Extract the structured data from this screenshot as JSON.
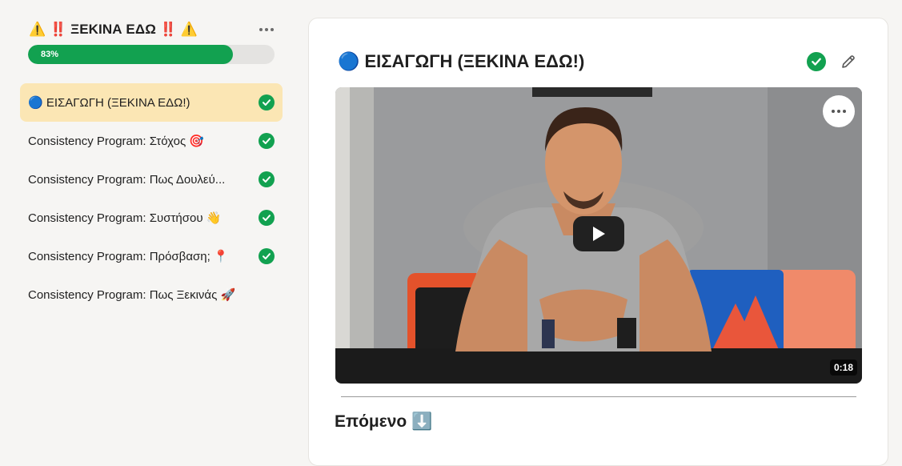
{
  "sidebar": {
    "section_title": "⚠️ ‼️ ΞΕΚΙΝΑ ΕΔΩ ‼️ ⚠️",
    "more_icon": "more-dots-icon",
    "progress": {
      "value": 0.83,
      "label": "83%"
    },
    "lessons": [
      {
        "label": "🔵 ΕΙΣΑΓΩΓΗ (ΞΕΚΙΝΑ ΕΔΩ!)",
        "completed": true,
        "active": true
      },
      {
        "label": "Consistency Program: Στόχος 🎯",
        "completed": true,
        "active": false
      },
      {
        "label": "Consistency Program: Πως Δουλεύ...",
        "completed": true,
        "active": false
      },
      {
        "label": "Consistency Program: Συστήσου 👋",
        "completed": true,
        "active": false
      },
      {
        "label": "Consistency Program: Πρόσβαση; 📍",
        "completed": true,
        "active": false
      },
      {
        "label": "Consistency Program: Πως Ξεκινάς 🚀",
        "completed": false,
        "active": false
      }
    ]
  },
  "main": {
    "lesson_title": "🔵 ΕΙΣΑΓΩΓΗ (ΞΕΚΙΝΑ ΕΔΩ!)",
    "completed": true,
    "edit_icon": "pencil-icon",
    "video": {
      "duration": "0:18",
      "play_icon": "play-icon",
      "more_icon": "more-dots-icon"
    },
    "next_heading": "Επόμενο ⬇️"
  },
  "colors": {
    "accent_green": "#12a150",
    "active_lesson_bg": "#fbe6b4",
    "page_bg": "#f6f5f3"
  }
}
